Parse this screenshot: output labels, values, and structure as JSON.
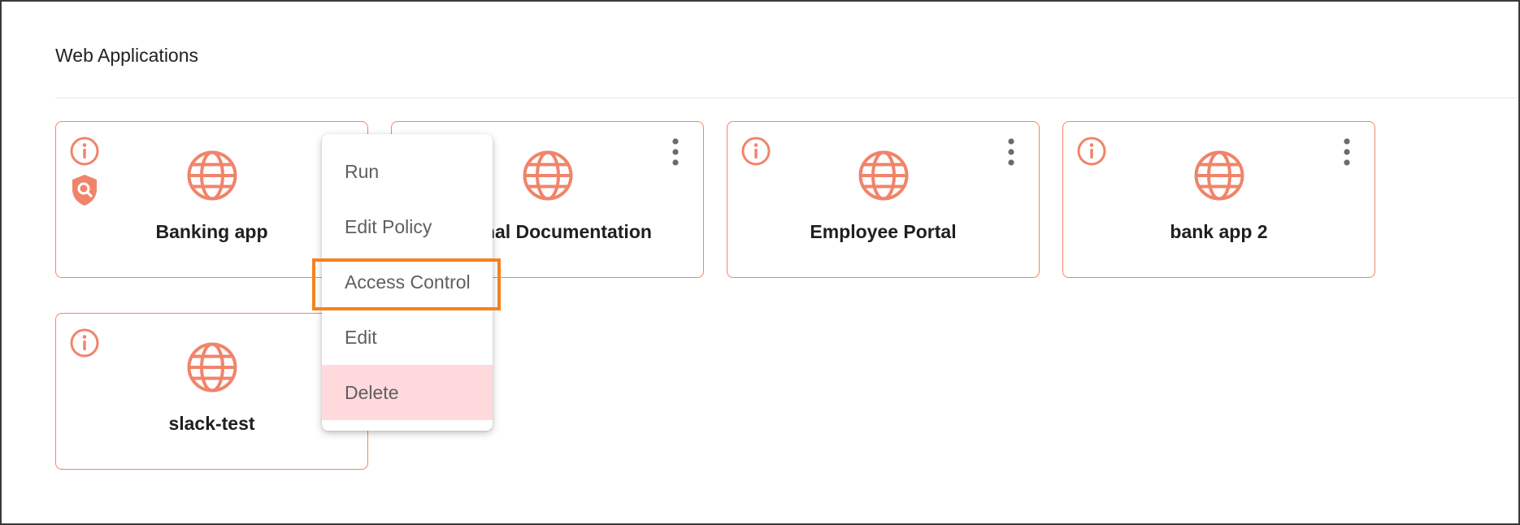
{
  "section": {
    "title": "Web Applications"
  },
  "colors": {
    "accent": "#f0846a",
    "highlight": "#f58220",
    "danger_bg": "#ffd9dc"
  },
  "apps": [
    {
      "name": "Banking app",
      "has_shield": true
    },
    {
      "name": "Internal Documentation",
      "has_shield": false
    },
    {
      "name": "Employee Portal",
      "has_shield": false
    },
    {
      "name": "bank app 2",
      "has_shield": false
    },
    {
      "name": "slack-test",
      "has_shield": false
    }
  ],
  "icons": {
    "info": "info-icon",
    "globe": "globe-icon",
    "shield": "shield-search-icon",
    "more": "kebab-menu-icon"
  },
  "context_menu": {
    "items": [
      {
        "label": "Run"
      },
      {
        "label": "Edit Policy"
      },
      {
        "label": "Access Control",
        "highlighted": true
      },
      {
        "label": "Edit"
      },
      {
        "label": "Delete",
        "danger": true
      }
    ]
  }
}
